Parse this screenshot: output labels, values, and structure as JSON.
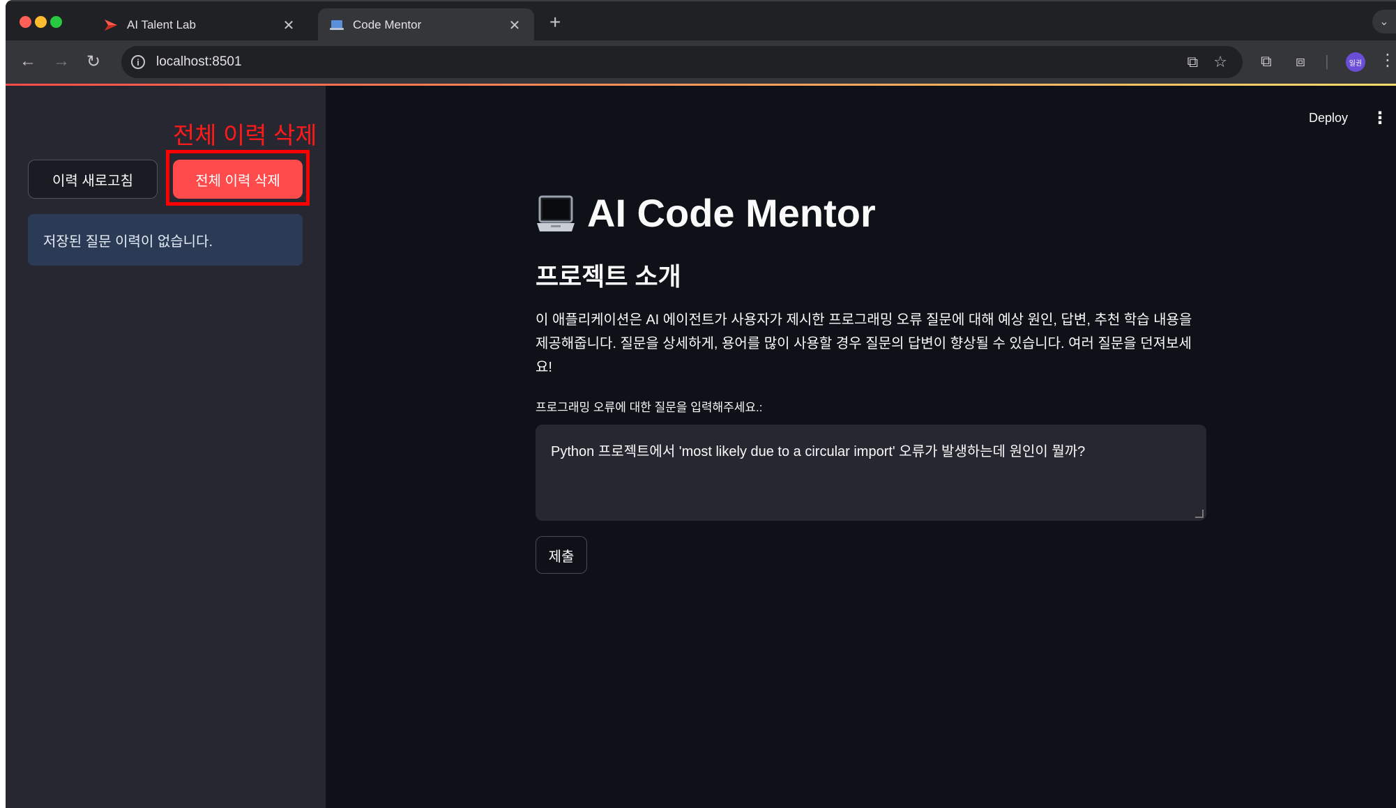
{
  "browser": {
    "tabs": [
      {
        "title": "AI Talent Lab",
        "active": false
      },
      {
        "title": "Code Mentor",
        "active": true
      }
    ],
    "url": "localhost:8501",
    "profile_initials": "일권"
  },
  "sidebar": {
    "refresh_label": "이력 새로고침",
    "delete_all_label": "전체 이력 삭제",
    "annotation_text": "전체 이력 삭제",
    "empty_history_message": "저장된 질문 이력이 없습니다."
  },
  "header": {
    "deploy_label": "Deploy"
  },
  "main": {
    "title": "AI Code Mentor",
    "section_title": "프로젝트 소개",
    "description": "이 애플리케이션은 AI 에이전트가 사용자가 제시한 프로그래밍 오류 질문에 대해 예상 원인, 답변, 추천 학습 내용을 제공해줍니다. 질문을 상세하게, 용어를 많이 사용할 경우 질문의 답변이 향상될 수 있습니다. 여러 질문을 던져보세요!",
    "input_label": "프로그래밍 오류에 대한 질문을 입력해주세요.:",
    "question_value": "Python 프로젝트에서 'most likely due to a circular import' 오류가 발생하는데 원인이 뭘까?",
    "submit_label": "제출"
  },
  "colors": {
    "primary": "#ff4b4b",
    "annotation": "#ff0000",
    "info_bg": "#2b3b55",
    "sidebar_bg": "#262730",
    "main_bg": "#0e1117"
  }
}
